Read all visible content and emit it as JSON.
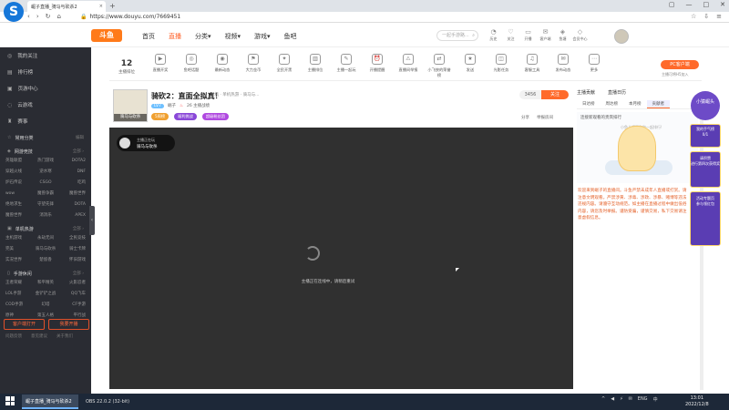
{
  "browser": {
    "tab_title": "崛子直播_骑马与砍杀2",
    "tab_close": "×",
    "new_tab": "+",
    "url": "https://www.douyu.com/7669451",
    "window_controls": [
      "▢",
      "—",
      "□",
      "✕"
    ],
    "nav_buttons": [
      "‹",
      "›",
      "↻",
      "⌂"
    ],
    "addr_right": [
      "☆",
      "⇩",
      "≡"
    ]
  },
  "site": {
    "logo": "斗鱼",
    "nav": [
      "首页",
      "直播",
      "分类▾",
      "视频▾",
      "游戏▾",
      "鱼吧"
    ],
    "active_nav": "直播",
    "search_placeholder": "一起手游路...",
    "header_icons": [
      {
        "icon": "◔",
        "label": "历史"
      },
      {
        "icon": "♡",
        "label": "关注"
      },
      {
        "icon": "▭",
        "label": "开播"
      },
      {
        "icon": "✉",
        "label": "客户端"
      },
      {
        "icon": "◈",
        "label": "鱼塘"
      },
      {
        "icon": "◇",
        "label": "会员中心"
      }
    ]
  },
  "sidebar": {
    "main": [
      {
        "icon": "◎",
        "label": "我的关注"
      },
      {
        "icon": "▤",
        "label": "排行榜"
      },
      {
        "icon": "▣",
        "label": "页游中心"
      },
      {
        "icon": "◌",
        "label": "云游戏"
      },
      {
        "icon": "♜",
        "label": "赛事"
      }
    ],
    "section_common": "常用分类",
    "section_common_more": "编辑",
    "section_online": "网游竞技",
    "online_items": [
      "英雄联盟",
      "热门游戏",
      "DOTA2",
      "穿越火线",
      "逆水寒",
      "DNF",
      "炉石传说",
      "CSGO",
      "吃鸡",
      "wow",
      "魔兽争霸",
      "魔兽世界",
      "绝地求生",
      "守望先锋",
      "DOTA",
      "魔兽世界",
      "消消乐",
      "APEX"
    ],
    "section_single": "单机热游",
    "single_items": [
      "主机游戏",
      "永劫无间",
      "全民竞技",
      "完美",
      "骑马与砍杀",
      "骑士卡牌",
      "实况世界",
      "楚留香",
      "怀旧游戏"
    ],
    "section_mobile": "手游休闲",
    "mobile_items": [
      "王者荣耀",
      "和平精英",
      "火影忍者",
      "LOL手游",
      "金铲铲之战",
      "QQ飞车",
      "COD手游",
      "幻塔",
      "CF手游",
      "原神",
      "第五人格",
      "平行战"
    ],
    "more_label": "全部 ›",
    "btn_open": "客户端打开",
    "btn_live": "我要开播",
    "footer": [
      "问题反馈",
      "意见建议",
      "关于我们"
    ]
  },
  "toolbar": {
    "rank_num": "12",
    "rank_label": "主播排位",
    "items": [
      {
        "icon": "▶",
        "label": "直播开奖"
      },
      {
        "icon": "◎",
        "label": "鱼吧话题"
      },
      {
        "icon": "◉",
        "label": "最新动态"
      },
      {
        "icon": "⚑",
        "label": "大力金币"
      },
      {
        "icon": "✦",
        "label": "全民开黑"
      },
      {
        "icon": "▥",
        "label": "主播排位"
      },
      {
        "icon": "✎",
        "label": "主播一起玩"
      },
      {
        "icon": "⏰",
        "label": "开播提醒"
      },
      {
        "icon": "⚠",
        "label": "直播间举报"
      },
      {
        "icon": "⇄",
        "label": "小飞侠的荣誉榜"
      },
      {
        "icon": "★",
        "label": "发送"
      },
      {
        "icon": "◫",
        "label": "光影任务"
      },
      {
        "icon": "♫",
        "label": "客服工具"
      },
      {
        "icon": "✉",
        "label": "发布动态"
      },
      {
        "icon": "⋯",
        "label": "更多"
      }
    ],
    "pc_btn": "PC客户端",
    "pc_sub": "主播可将H5加入"
  },
  "room": {
    "thumb_label": "骑马与砍杀",
    "title": "骑砍2：直面全拟真！",
    "tags": "单机 · 单机热游 · 骑马与...",
    "level": "LV7",
    "anchor": "崛子",
    "followers": "26 主播战绩",
    "badges": [
      "5周榜",
      "福利挑战",
      "超级粉丝团"
    ],
    "badge_colors": [
      "#f0a030",
      "#8a48d8",
      "#b049e0"
    ],
    "follow_count": "3456",
    "follow_btn": "关注",
    "share": "分享",
    "report": "举报房间"
  },
  "player": {
    "pill_title": "主播正在玩",
    "pill_name": "骑马与砍杀",
    "message": "主播正在连线中，请稍后重试"
  },
  "right_panel": {
    "tabs": [
      "主播贡献",
      "直播日历"
    ],
    "sub_tabs": [
      "日达榜",
      "周达榜",
      "本月榜",
      "贡献者"
    ],
    "card_head": "连接新观看的贵宾排行",
    "card_msg": "小鱼儿想要和你一起排行!",
    "notice": "欢迎来到崛子的直播间。斗鱼严禁未成年人直播或打赏。请注意文明观看。严禁涉黄、涉毒、涉政、涉暴、赌博等违法违规内容。请遵守互动规范。如主播在直播过程中做出低俗内容，请您及时举报。谨防受骗，谨慎交易，私下交易请注意虚假信息。",
    "float_top": "小猿崛头",
    "float_cards": [
      {
        "t": "我的手气榜",
        "s": "0/1"
      },
      {
        "t": "请积赞",
        "s": "进行第四次获得奖"
      },
      {
        "t": "活动专题页",
        "s": "参与领红包"
      }
    ]
  },
  "taskbar": {
    "start": "⊞",
    "tasks": [
      "崛子直播_骑马与砍杀2",
      "OBS 22.0.2 (32-bit)"
    ],
    "tray": [
      "^",
      "◀",
      "⚡",
      "✉",
      "ENG",
      "中"
    ],
    "time": "13:01",
    "date": "2022/12/8"
  },
  "colors": {
    "accent": "#ff6a2b",
    "sidebar_bg": "#2a2c33",
    "player_bg": "#303030",
    "taskbar_bg": "#1d2838",
    "float_purple": "#5a3db3"
  }
}
